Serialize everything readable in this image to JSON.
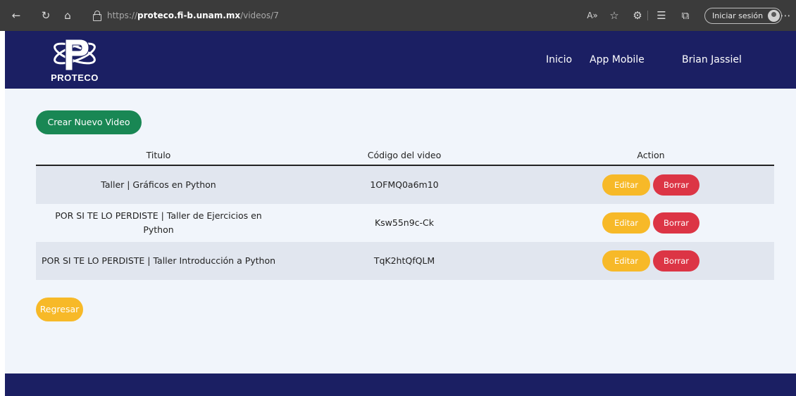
{
  "browser": {
    "url_scheme": "https://",
    "url_host": "proteco.fi-b.unam.mx",
    "url_path": "/videos/7",
    "signin_label": "Iniciar sesión",
    "icons": [
      "back-arrow-icon",
      "refresh-icon",
      "home-icon",
      "lock-icon",
      "read-aloud-icon",
      "favorite-icon",
      "extensions-icon",
      "favorites-list-icon",
      "collections-icon",
      "more-icon"
    ]
  },
  "header": {
    "logo_text": "PROTECO",
    "nav": {
      "inicio": "Inicio",
      "app_mobile": "App Mobile",
      "user": "Brian Jassiel"
    }
  },
  "main": {
    "create_label": "Crear Nuevo Video",
    "back_label": "Regresar",
    "table": {
      "headers": [
        "Titulo",
        "Código del video",
        "Action"
      ],
      "edit_label": "Editar",
      "delete_label": "Borrar",
      "rows": [
        {
          "title": "Taller | Gráficos en Python",
          "code": "1OFMQ0a6m10"
        },
        {
          "title": "POR SI TE LO PERDISTE | Taller de Ejercicios en Python",
          "code": "Ksw55n9c-Ck"
        },
        {
          "title": "POR SI TE LO PERDISTE | Taller Introducción a Python",
          "code": "TqK2htQfQLM"
        }
      ]
    }
  },
  "colors": {
    "header_bg": "#1b1f63",
    "page_bg": "#f1f5fb",
    "create_btn": "#198754",
    "edit_btn": "#f7b928",
    "delete_btn": "#dc3545",
    "row_stripe": "#e1e6ef"
  }
}
